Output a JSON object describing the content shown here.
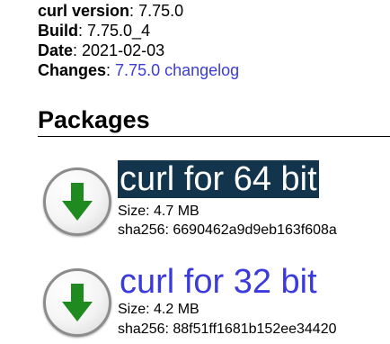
{
  "meta": {
    "version_label": "curl version",
    "version_value": "7.75.0",
    "build_label": "Build",
    "build_value": "7.75.0_4",
    "date_label": "Date",
    "date_value": "2021-02-03",
    "changes_label": "Changes",
    "changes_link": "7.75.0 changelog"
  },
  "packages_section": {
    "title": "Packages",
    "items": [
      {
        "title": "curl for 64 bit",
        "size": "Size: 4.7 MB",
        "sha": "sha256: 6690462a9d9eb163f608a",
        "icon": "download-arrow-icon",
        "state": "hovered"
      },
      {
        "title": "curl for 32 bit",
        "size": "Size: 4.2 MB",
        "sha": "sha256: 88f51ff1681b152ee34420",
        "icon": "download-arrow-icon",
        "state": "normal"
      }
    ]
  },
  "colors": {
    "link": "#3b3bdc",
    "active_link_bg": "#12344d",
    "arrow_green": "#1f8a1f"
  }
}
